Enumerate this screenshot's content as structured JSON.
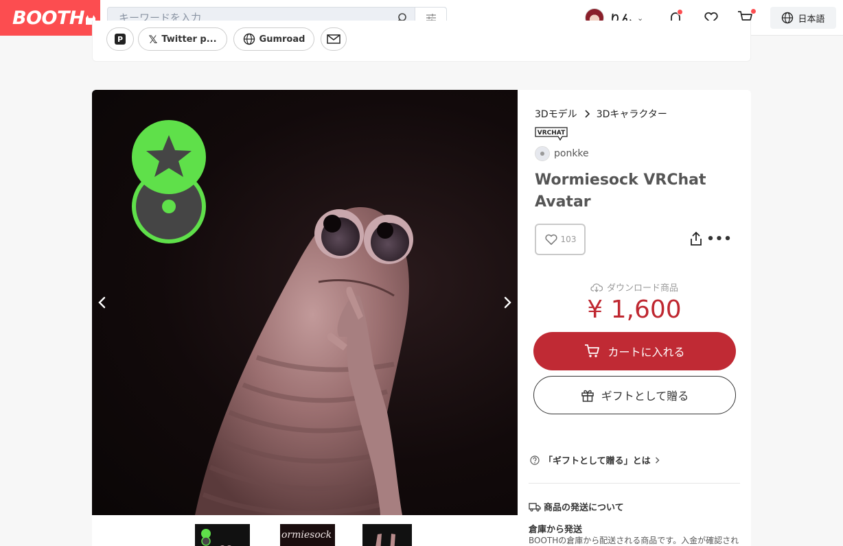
{
  "header": {
    "logo": "BOOTH",
    "search_placeholder": "キーワードを入力",
    "user_name": "りん",
    "language": "日本語"
  },
  "shop_links": {
    "twitter": "Twitter p...",
    "gumroad": "Gumroad"
  },
  "product": {
    "breadcrumb": [
      "3Dモデル",
      "3Dキャラクター"
    ],
    "badge": "VRCHAT",
    "shop_name": "ponkke",
    "title": "Wormiesock VRChat Avatar",
    "likes": "103",
    "download_label": "ダウンロード商品",
    "price": "¥ 1,600",
    "add_to_cart": "カートに入れる",
    "gift": "ギフトとして贈る",
    "gift_info": "「ギフトとして贈る」とは"
  },
  "shipping": {
    "title": "商品の発送について",
    "method": "倉庫から発送",
    "description": "BOOTHの倉庫から配送される商品です。入金が確認され"
  },
  "thumbnails": {
    "second_caption": "ormiesock"
  },
  "colors": {
    "brand": "#fc4d50",
    "price": "#bf2730",
    "cart_button": "#c02a34",
    "badge_green": "#5fe04a"
  }
}
